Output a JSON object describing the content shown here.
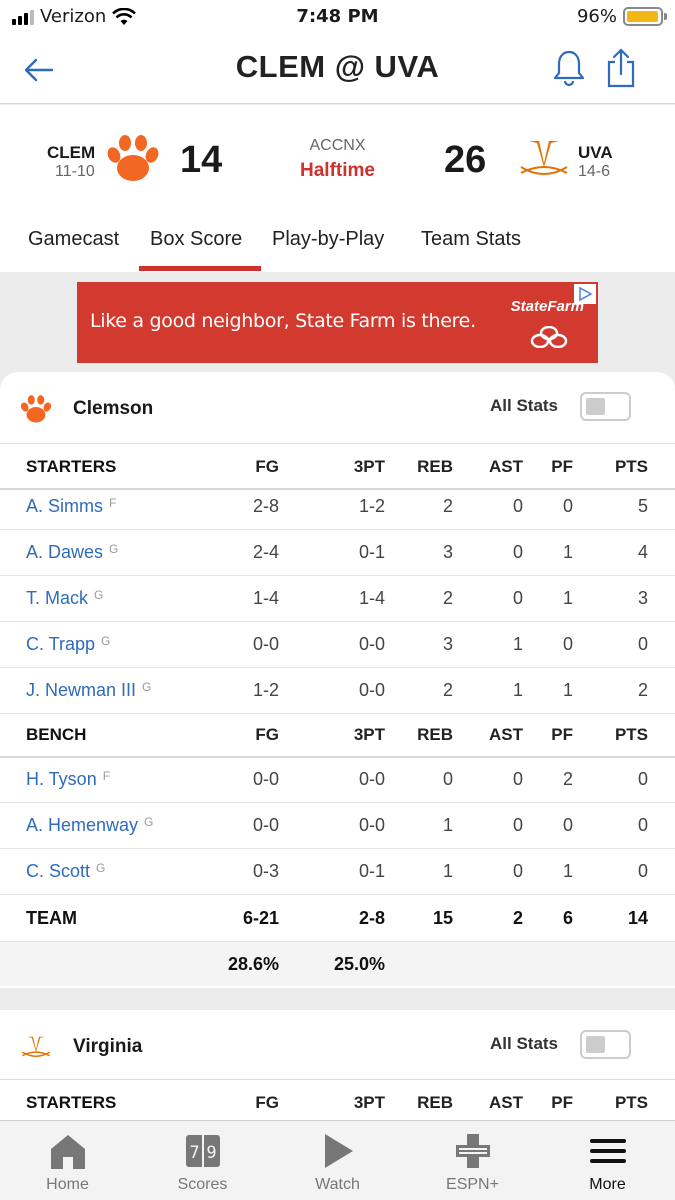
{
  "status_bar": {
    "carrier": "Verizon",
    "time": "7:48 PM",
    "battery": "96%"
  },
  "header": {
    "title": "CLEM @ UVA"
  },
  "scoreboard": {
    "away": {
      "abbr": "CLEM",
      "record": "11-10",
      "score": "14"
    },
    "home": {
      "abbr": "UVA",
      "record": "14-6",
      "score": "26"
    },
    "network": "ACCNX",
    "period": "Halftime"
  },
  "tabs": [
    "Gamecast",
    "Box Score",
    "Play-by-Play",
    "Team Stats"
  ],
  "ad": {
    "text": "Like a good neighbor, State Farm is there.",
    "brand": "StateFarm"
  },
  "clemson": {
    "name": "Clemson",
    "all_stats_label": "All Stats",
    "starters_header": [
      "STARTERS",
      "FG",
      "3PT",
      "REB",
      "AST",
      "PF",
      "PTS"
    ],
    "starters": [
      {
        "name": "A. Simms",
        "pos": "F",
        "fg": "2-8",
        "tpt": "1-2",
        "reb": "2",
        "ast": "0",
        "pf": "0",
        "pts": "5"
      },
      {
        "name": "A. Dawes",
        "pos": "G",
        "fg": "2-4",
        "tpt": "0-1",
        "reb": "3",
        "ast": "0",
        "pf": "1",
        "pts": "4"
      },
      {
        "name": "T. Mack",
        "pos": "G",
        "fg": "1-4",
        "tpt": "1-4",
        "reb": "2",
        "ast": "0",
        "pf": "1",
        "pts": "3"
      },
      {
        "name": "C. Trapp",
        "pos": "G",
        "fg": "0-0",
        "tpt": "0-0",
        "reb": "3",
        "ast": "1",
        "pf": "0",
        "pts": "0"
      },
      {
        "name": "J. Newman III",
        "pos": "G",
        "fg": "1-2",
        "tpt": "0-0",
        "reb": "2",
        "ast": "1",
        "pf": "1",
        "pts": "2"
      }
    ],
    "bench_header": [
      "BENCH",
      "FG",
      "3PT",
      "REB",
      "AST",
      "PF",
      "PTS"
    ],
    "bench": [
      {
        "name": "H. Tyson",
        "pos": "F",
        "fg": "0-0",
        "tpt": "0-0",
        "reb": "0",
        "ast": "0",
        "pf": "2",
        "pts": "0"
      },
      {
        "name": "A. Hemenway",
        "pos": "G",
        "fg": "0-0",
        "tpt": "0-0",
        "reb": "1",
        "ast": "0",
        "pf": "0",
        "pts": "0"
      },
      {
        "name": "C. Scott",
        "pos": "G",
        "fg": "0-3",
        "tpt": "0-1",
        "reb": "1",
        "ast": "0",
        "pf": "1",
        "pts": "0"
      }
    ],
    "team": {
      "label": "TEAM",
      "fg": "6-21",
      "tpt": "2-8",
      "reb": "15",
      "ast": "2",
      "pf": "6",
      "pts": "14"
    },
    "pct": {
      "fg": "28.6%",
      "tpt": "25.0%"
    }
  },
  "virginia": {
    "name": "Virginia",
    "all_stats_label": "All Stats",
    "starters_header": [
      "STARTERS",
      "FG",
      "3PT",
      "REB",
      "AST",
      "PF",
      "PTS"
    ]
  },
  "tabbar": [
    {
      "label": "Home",
      "icon": "home-icon"
    },
    {
      "label": "Scores",
      "icon": "scores-icon"
    },
    {
      "label": "Watch",
      "icon": "play-icon"
    },
    {
      "label": "ESPN+",
      "icon": "espn-plus-icon"
    },
    {
      "label": "More",
      "icon": "menu-icon"
    }
  ],
  "colors": {
    "accent": "#d0312d",
    "link": "#2f6bbd",
    "clemson_orange": "#f26722",
    "uva_orange": "#e57200"
  }
}
